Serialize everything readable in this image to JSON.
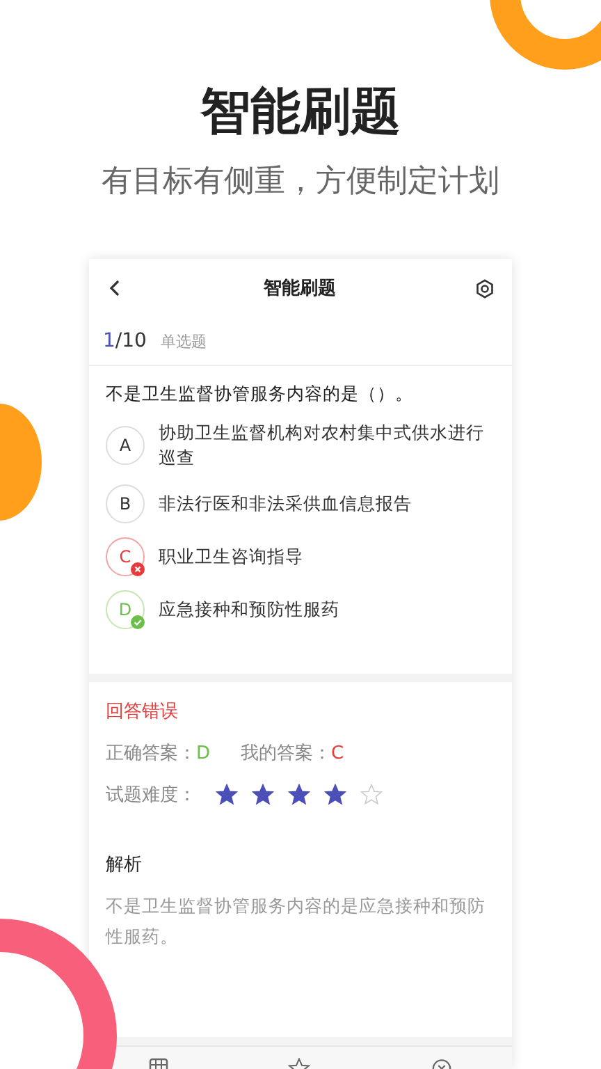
{
  "headline": "智能刷题",
  "subtitle": "有目标有侧重，方便制定计划",
  "screen": {
    "title": "智能刷题"
  },
  "progress": {
    "current": "1",
    "rest": "/10",
    "type": "单选题"
  },
  "question": "不是卫生监督协管服务内容的是（）。",
  "options": [
    {
      "letter": "A",
      "text": "协助卫生监督机构对农村集中式供水进行巡查",
      "kind": "plain"
    },
    {
      "letter": "B",
      "text": "非法行医和非法采供血信息报告",
      "kind": "plain"
    },
    {
      "letter": "C",
      "text": "职业卫生咨询指导",
      "kind": "wrong"
    },
    {
      "letter": "D",
      "text": "应急接种和预防性服药",
      "kind": "correct"
    }
  ],
  "feedback": {
    "status": "回答错误",
    "correct_label": "正确答案：",
    "correct": "D",
    "mine_label": "我的答案：",
    "mine": "C",
    "difficulty_label": "试题难度：",
    "stars": 4
  },
  "analysis": {
    "title": "解析",
    "text": "不是卫生监督协管服务内容的是应急接种和预防性服药。"
  }
}
